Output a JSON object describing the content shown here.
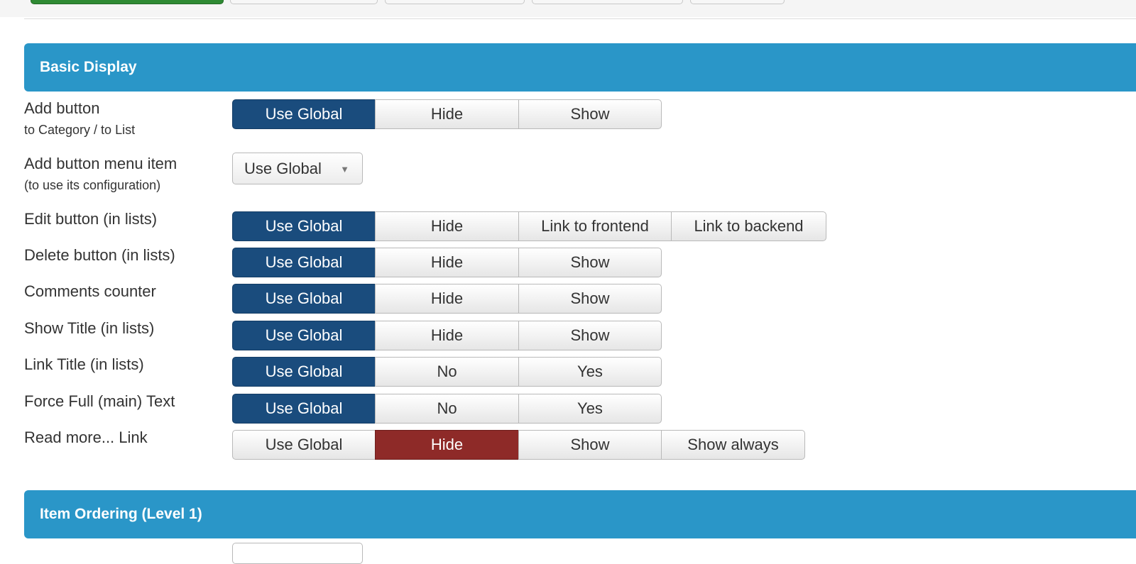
{
  "sections": {
    "basic_display": "Basic Display",
    "item_ordering": "Item Ordering (Level 1)"
  },
  "rows": {
    "add_button": {
      "label": "Add button",
      "sublabel": "to Category / to List",
      "options": [
        "Use Global",
        "Hide",
        "Show"
      ],
      "selected": "Use Global"
    },
    "add_button_menu_item": {
      "label": "Add button menu item",
      "sublabel": "(to use its configuration)",
      "select_value": "Use Global",
      "caret_icon": "▼"
    },
    "edit_button": {
      "label": "Edit button (in lists)",
      "options": [
        "Use Global",
        "Hide",
        "Link to frontend",
        "Link to backend"
      ],
      "selected": "Use Global"
    },
    "delete_button": {
      "label": "Delete button (in lists)",
      "options": [
        "Use Global",
        "Hide",
        "Show"
      ],
      "selected": "Use Global"
    },
    "comments_counter": {
      "label": "Comments counter",
      "options": [
        "Use Global",
        "Hide",
        "Show"
      ],
      "selected": "Use Global"
    },
    "show_title": {
      "label": "Show Title (in lists)",
      "options": [
        "Use Global",
        "Hide",
        "Show"
      ],
      "selected": "Use Global"
    },
    "link_title": {
      "label": "Link Title (in lists)",
      "options": [
        "Use Global",
        "No",
        "Yes"
      ],
      "selected": "Use Global"
    },
    "force_full_text": {
      "label": "Force Full (main) Text",
      "options": [
        "Use Global",
        "No",
        "Yes"
      ],
      "selected": "Use Global"
    },
    "read_more_link": {
      "label": "Read more... Link",
      "options": [
        "Use Global",
        "Hide",
        "Show",
        "Show always"
      ],
      "selected": "Hide"
    }
  },
  "colors": {
    "section_header": "#2a96c8",
    "active_blue": "#1a4c7d",
    "active_red": "#8e2a28",
    "toolbar_green": "#2f8a33"
  }
}
